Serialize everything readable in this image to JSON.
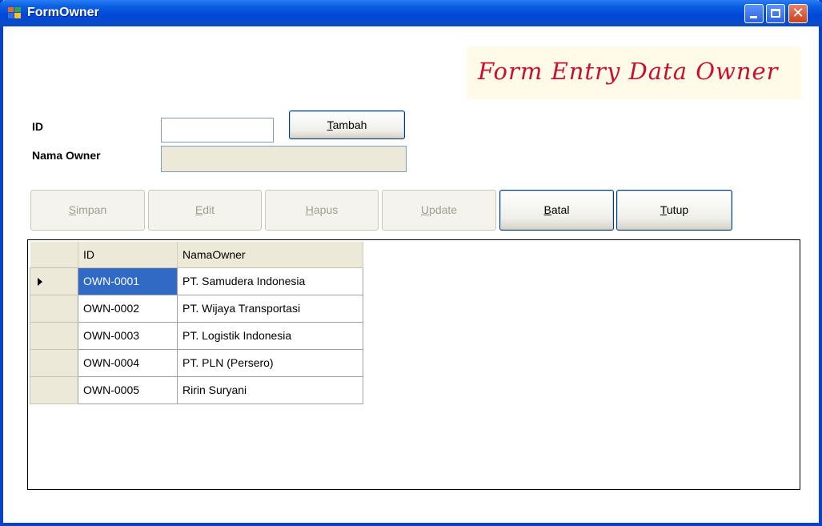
{
  "window": {
    "title": "FormOwner"
  },
  "banner": {
    "text": "Form Entry Data Owner"
  },
  "form": {
    "id_label": "ID",
    "nama_label": "Nama Owner",
    "id_value": "",
    "nama_value": ""
  },
  "buttons": {
    "tambah": "Tambah",
    "simpan": "Simpan",
    "edit": "Edit",
    "hapus": "Hapus",
    "update": "Update",
    "batal": "Batal",
    "tutup": "Tutup"
  },
  "grid": {
    "columns": [
      "ID",
      "NamaOwner"
    ],
    "rows": [
      [
        "OWN-0001",
        "PT. Samudera Indonesia"
      ],
      [
        "OWN-0002",
        "PT. Wijaya Transportasi"
      ],
      [
        "OWN-0003",
        "PT. Logistik Indonesia"
      ],
      [
        "OWN-0004",
        "PT. PLN (Persero)"
      ],
      [
        "OWN-0005",
        "Ririn Suryani"
      ]
    ],
    "selected_row": 0
  },
  "colors": {
    "title_bar": "#0a5ee0",
    "banner_text": "#c8102e",
    "selection": "#316ac5"
  }
}
